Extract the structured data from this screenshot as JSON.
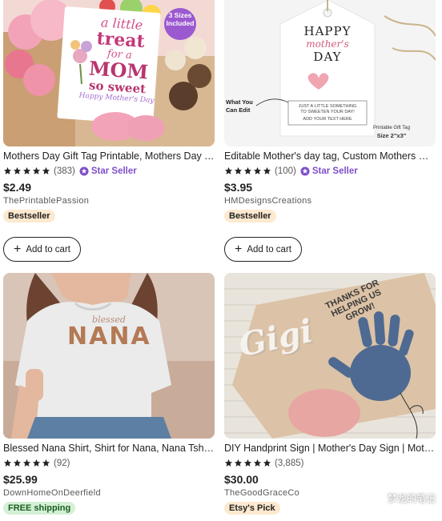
{
  "listings": [
    {
      "title": "Mothers Day Gift Tag Printable, Mothers Day Treat Tag, A Little Treat for a Mom So Sweet",
      "rating_count": "(383)",
      "star_seller": "Star Seller",
      "price": "$2.49",
      "shop": "ThePrintablePassion",
      "badge": "Bestseller",
      "cart_label": "Add to cart",
      "image": {
        "size_badge_line1": "3 Sizes",
        "size_badge_line2": "Included",
        "card_lines": [
          "a little",
          "treat",
          "for a",
          "MOM",
          "so sweet",
          "Happy Mother's Day"
        ]
      }
    },
    {
      "title": "Editable Mother's day tag, Custom Mothers Day Gift Tag",
      "rating_count": "(100)",
      "star_seller": "Star Seller",
      "price": "$3.95",
      "shop": "HMDesignsCreations",
      "badge": "Bestseller",
      "cart_label": "Add to cart",
      "image": {
        "tag_line1": "HAPPY",
        "tag_line2": "mother's",
        "tag_line3": "DAY",
        "editable_line1": "JUST A LITTLE SOMETHING",
        "editable_line2": "TO SWEETEN YOUR DAY!",
        "editable_line3": "ADD YOUR TEXT HERE",
        "callout_line1": "What You",
        "callout_line2": "Can Edit",
        "size_line1": "Printable Gift Tag",
        "size_line2": "Size  2\"x3\""
      }
    },
    {
      "title": "Blessed Nana Shirt, Shirt for Nana, Nana Tshirt, Grandma Gift",
      "rating_count": "(92)",
      "price": "$25.99",
      "shop": "DownHomeOnDeerfield",
      "badge": "FREE shipping",
      "image": {
        "shirt_line1": "blessed",
        "shirt_line2": "NANA"
      }
    },
    {
      "title": "DIY Handprint Sign | Mother's Day Sign | Mother's Day Gift",
      "rating_count": "(3,885)",
      "price": "$30.00",
      "shop": "TheGoodGraceCo",
      "badge": "Etsy's Pick",
      "image": {
        "sign_name": "Gigi",
        "sign_line1": "THANKS FOR",
        "sign_line2": "HELPING US",
        "sign_line3": "GROW!"
      }
    }
  ],
  "watermark": "梦龙的笔记",
  "colors": {
    "star_seller": "#7f4fc9",
    "bestseller_bg": "#fde9cf",
    "free_shipping_bg": "#d4f0d6",
    "price": "#222222"
  },
  "icons": [
    "star-icon",
    "star-seller-icon",
    "plus-icon",
    "wechat-icon"
  ]
}
